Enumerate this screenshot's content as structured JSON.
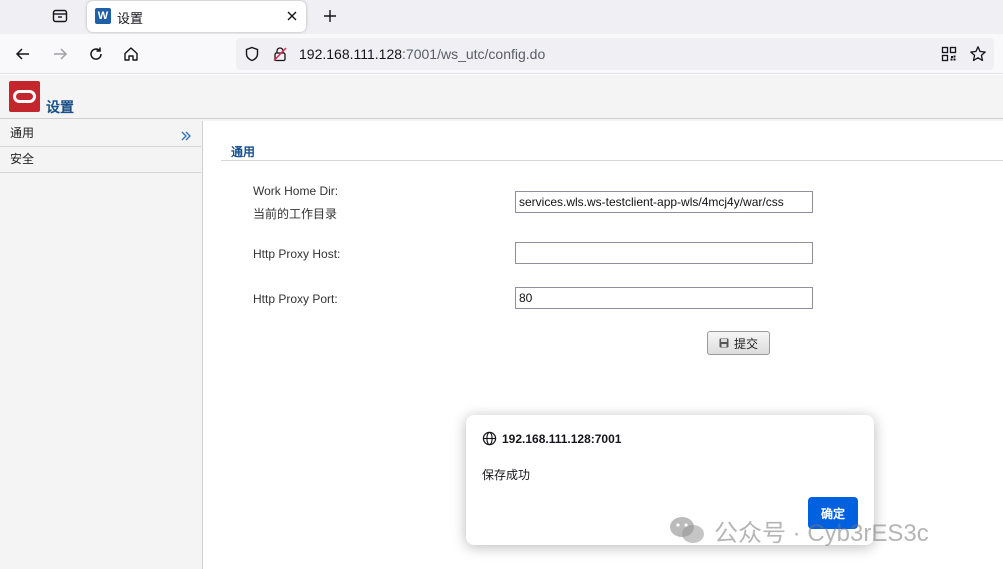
{
  "browser": {
    "tab": {
      "title": "设置"
    },
    "url": {
      "host": "192.168.111.128",
      "rest": ":7001/ws_utc/config.do"
    }
  },
  "page": {
    "title": "设置",
    "sidebar": {
      "items": [
        {
          "label": "通用"
        },
        {
          "label": "安全"
        }
      ]
    },
    "section": {
      "title": "通用",
      "fields": [
        {
          "label": "Work Home Dir:",
          "sublabel": "当前的工作目录",
          "value": "services.wls.ws-testclient-app-wls/4mcj4y/war/css"
        },
        {
          "label": "Http Proxy Host:",
          "value": ""
        },
        {
          "label": "Http Proxy Port:",
          "value": "80"
        }
      ],
      "submit_label": "提交"
    }
  },
  "dialog": {
    "origin": "192.168.111.128:7001",
    "message": "保存成功",
    "ok_label": "确定"
  },
  "watermark": {
    "text": "公众号 · Cyb3rES3c"
  },
  "colors": {
    "brand_red": "#c4262e",
    "heading_blue": "#1a4f8a",
    "button_blue": "#0061e0"
  }
}
